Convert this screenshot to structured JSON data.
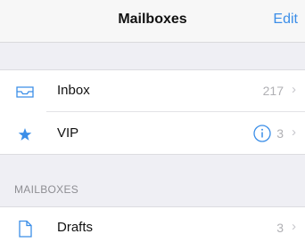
{
  "navbar": {
    "title": "Mailboxes",
    "edit_label": "Edit"
  },
  "colors": {
    "accent": "#3b8ee8",
    "background": "#efeff4",
    "secondary_text": "#8e8e93"
  },
  "mailboxes_top": [
    {
      "label": "Inbox",
      "count": "217",
      "icon": "inbox-tray-icon"
    },
    {
      "label": "VIP",
      "count": "3",
      "icon": "star-icon",
      "secondary_icon": "info-icon"
    }
  ],
  "section": {
    "header": "MAILBOXES"
  },
  "mailboxes_section": [
    {
      "label": "Drafts",
      "count": "3",
      "icon": "document-icon"
    }
  ],
  "chevron": "›"
}
